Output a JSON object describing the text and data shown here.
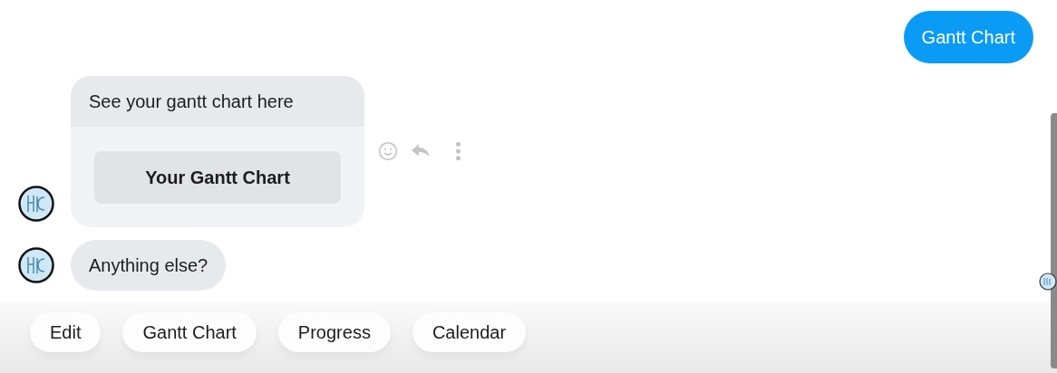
{
  "messages": [
    {
      "kind": "sent",
      "text": "Gantt Chart"
    },
    {
      "kind": "card",
      "text": "See your gantt chart here",
      "button": "Your Gantt Chart"
    },
    {
      "kind": "received",
      "text": "Anything else?"
    }
  ],
  "quick_replies": [
    "Edit",
    "Gantt Chart",
    "Progress",
    "Calendar"
  ]
}
